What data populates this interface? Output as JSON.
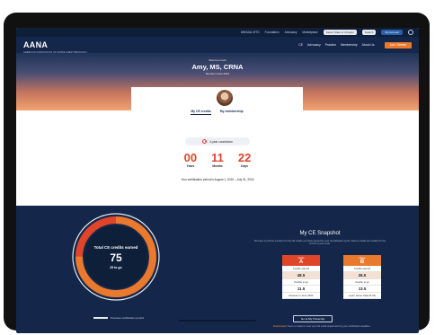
{
  "utility": {
    "links": [
      "ANNUAL MTG",
      "Foundation",
      "Advocacy",
      "Marketplace"
    ],
    "chapter_select": "Select State or Chapter",
    "search_placeholder": "Search",
    "account_label": "My Account"
  },
  "nav": {
    "logo": "AANA",
    "logo_sub": "AMERICAN ASSOCIATION OF NURSE ANESTHESIOLOGY",
    "menu": [
      "CE",
      "Advocacy",
      "Practice",
      "Membership",
      "About Us"
    ],
    "cta": "Join / Renew"
  },
  "hero": {
    "welcome": "Welcome back",
    "name": "Amy, MS, CRNA",
    "role": "Member since 2012"
  },
  "tabs": [
    "My CE credits",
    "My membership"
  ],
  "countdown": {
    "pill_label": "4-year countdown",
    "units": [
      {
        "value": "00",
        "label": "Years"
      },
      {
        "value": "11",
        "label": "Months"
      },
      {
        "value": "22",
        "label": "Days"
      }
    ],
    "note": "Your certification period is August 1, 2020 – July 31, 2024"
  },
  "donut": {
    "label": "Total CE credits earned",
    "value": "75",
    "to_go": "25 to go",
    "fraction_earned": 0.75,
    "legend": "Previous certification period"
  },
  "snapshot": {
    "title": "My CE Snapshot",
    "description": "We have to pull the numbers for the CE credits you have earned for your recertification cycle. Class A credits are tracked for the current 4-year cycle.",
    "cards": [
      {
        "period": "Class",
        "letter": "A",
        "rows": [
          {
            "label": "Credits earned",
            "value": "48.5"
          },
          {
            "label": "Credits to go",
            "value": "11.5"
          }
        ],
        "footer": "Renews in June 2024"
      },
      {
        "period": "Class",
        "letter": "B",
        "rows": [
          {
            "label": "Credits earned",
            "value": "26.5"
          },
          {
            "label": "Credits to go",
            "value": "13.5"
          }
        ],
        "footer": "Learn about Class B CE"
      }
    ],
    "button": "Go to My Transcript",
    "note_prefix": "Good news!",
    "note": "You’re on track to meet your CE credit requirement by your certification deadline."
  },
  "colors": {
    "navy": "#14274a",
    "orange": "#e8792d",
    "red": "#e0452a"
  }
}
